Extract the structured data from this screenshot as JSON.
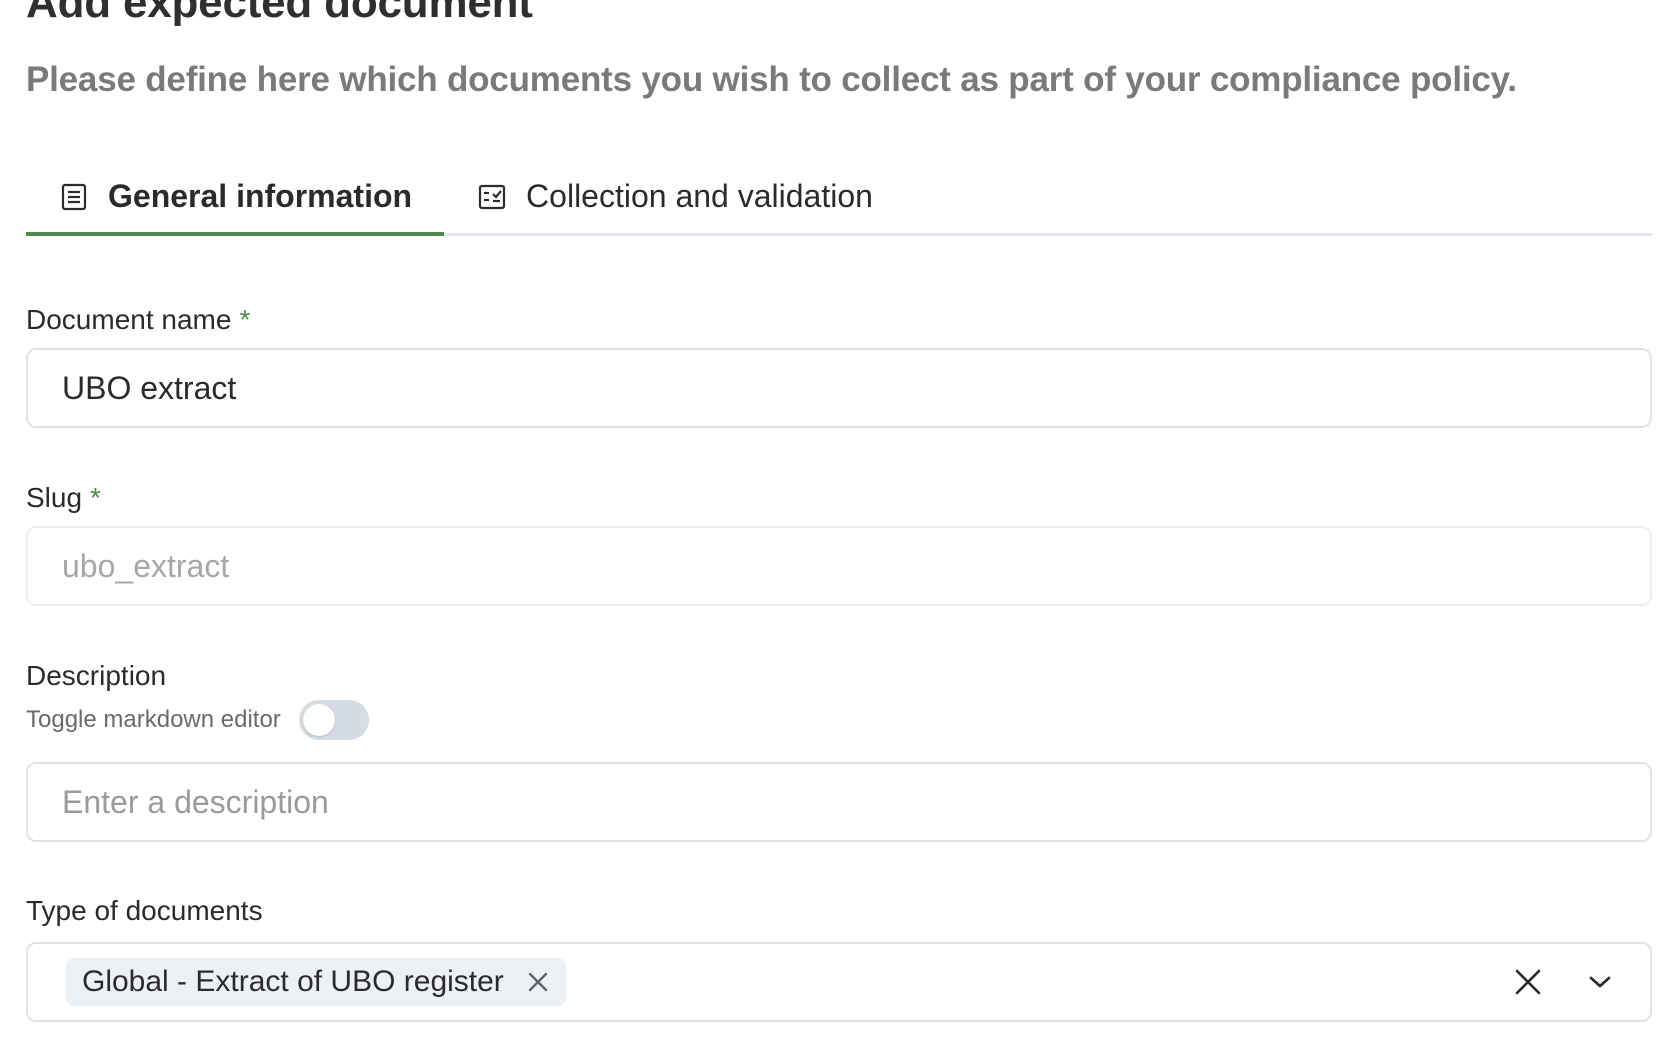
{
  "header": {
    "title": "Add expected document",
    "subtitle": "Please define here which documents you wish to collect as part of your compliance policy."
  },
  "tabs": [
    {
      "label": "General information",
      "icon": "document-list-icon",
      "active": true
    },
    {
      "label": "Collection and validation",
      "icon": "checklist-icon",
      "active": false
    }
  ],
  "form": {
    "document_name": {
      "label": "Document name",
      "required_mark": "*",
      "value": "UBO extract"
    },
    "slug": {
      "label": "Slug",
      "required_mark": "*",
      "value": "ubo_extract"
    },
    "description": {
      "label": "Description",
      "toggle_label": "Toggle markdown editor",
      "toggle_on": false,
      "placeholder": "Enter a description"
    },
    "type_of_documents": {
      "label": "Type of documents",
      "selected": [
        "Global - Extract of UBO register"
      ]
    }
  },
  "colors": {
    "accent": "#4f8a4a",
    "subtitle": "#7a7a7a",
    "border": "#dfe3e8",
    "chip_bg": "#edf1f5",
    "toggle_off": "#d5dce5"
  }
}
